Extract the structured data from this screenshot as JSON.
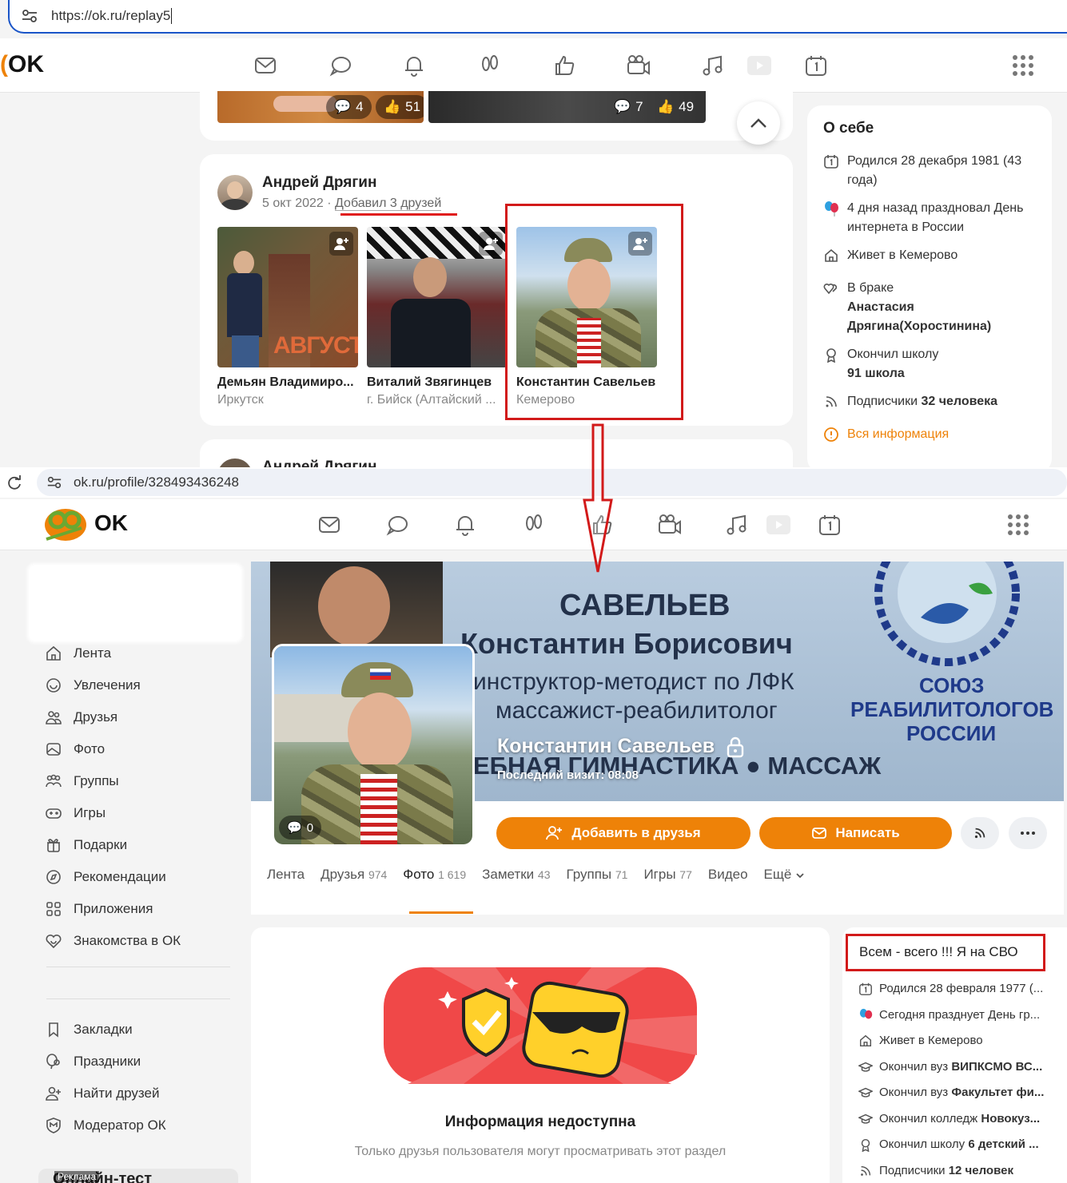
{
  "top": {
    "browser": {
      "url": "https://ok.ru/replay5"
    },
    "brand": {
      "logo_text": "OK"
    },
    "prev_post": {
      "photo1_comments": "4",
      "photo1_likes": "51",
      "photo2_comments": "7",
      "photo2_likes": "49"
    },
    "post": {
      "author": "Андрей Дрягин",
      "date": "5 окт 2022",
      "separator": "·",
      "action": "Добавил 3 друзей",
      "friends": [
        {
          "name": "Демьян Владимиро...",
          "city": "Иркутск"
        },
        {
          "name": "Виталий Звягинцев",
          "city": "г. Бийск (Алтайский ..."
        },
        {
          "name": "Константин Савельев",
          "city": "Кемерово"
        }
      ],
      "poster_text": "АВГУСТ"
    },
    "next_post": {
      "author": "Андрей Дрягин"
    },
    "about": {
      "title": "О себе",
      "born": "Родился 28 декабря 1981 (43 года)",
      "holiday": "4 дня назад праздновал День интернета в России",
      "lives": "Живет в Кемерово",
      "married_prefix": "В браке",
      "married_name": "Анастасия Дрягина(Хоростинина)",
      "school_prefix": "Окончил школу",
      "school_name": "91 школа",
      "subs_prefix": "Подписчики",
      "subs_count": "32 человека",
      "all_info": "Вся информация"
    }
  },
  "bottom": {
    "browser": {
      "url": "ok.ru/profile/328493436248"
    },
    "brand": {
      "logo_text": "OK"
    },
    "sidebar": {
      "items": [
        "Лента",
        "Увлечения",
        "Друзья",
        "Фото",
        "Группы",
        "Игры",
        "Подарки",
        "Рекомендации",
        "Приложения",
        "Знакомства в ОК"
      ],
      "items2": [
        "Закладки",
        "Праздники",
        "Найти друзей",
        "Модератор ОК"
      ],
      "ad_label": "Реклама",
      "ad_title": "Онлайн-тест"
    },
    "cover": {
      "line1": "САВЕЛЬЕВ",
      "line2": "Константин Борисович",
      "line3": "инструктор-методист по ЛФК",
      "line4": "массажист-реабилитолог",
      "line5": "ЕБНАЯ ГИМНАСТИКА ● МАССАЖ",
      "org1": "СОЮЗ",
      "org2": "РЕАБИЛИТОЛОГОВ",
      "org3": "РОССИИ"
    },
    "profile": {
      "name": "Константин Савельев",
      "last_visit": "Последний визит: 08:08",
      "photo_comments": "0",
      "add_friend": "Добавить в друзья",
      "write": "Написать"
    },
    "tabs": [
      {
        "label": "Лента",
        "count": ""
      },
      {
        "label": "Друзья",
        "count": "974"
      },
      {
        "label": "Фото",
        "count": "1 619"
      },
      {
        "label": "Заметки",
        "count": "43"
      },
      {
        "label": "Группы",
        "count": "71"
      },
      {
        "label": "Игры",
        "count": "77"
      },
      {
        "label": "Видео",
        "count": ""
      },
      {
        "label": "Ещё",
        "count": ""
      }
    ],
    "main": {
      "title": "Информация недоступна",
      "subtitle": "Только друзья пользователя могут просматривать этот раздел"
    },
    "right": {
      "status": "Всем - всего !!! Я на СВО",
      "born": "Родился 28 февраля 1977 (...",
      "holiday": "Сегодня празднует День гр...",
      "lives": "Живет в Кемерово",
      "edu1_prefix": "Окончил вуз",
      "edu1_name": "ВИПКСМО ВС...",
      "edu2_prefix": "Окончил вуз",
      "edu2_name": "Факультет фи...",
      "edu3_prefix": "Окончил колледж",
      "edu3_name": "Новокуз...",
      "edu4_prefix": "Окончил школу",
      "edu4_name": "6 детский ...",
      "subs_prefix": "Подписчики",
      "subs_count": "12 человек"
    }
  },
  "colors": {
    "accent": "#ee8208",
    "annotation_red": "#d21a1a",
    "url_border": "#1a55c8"
  }
}
